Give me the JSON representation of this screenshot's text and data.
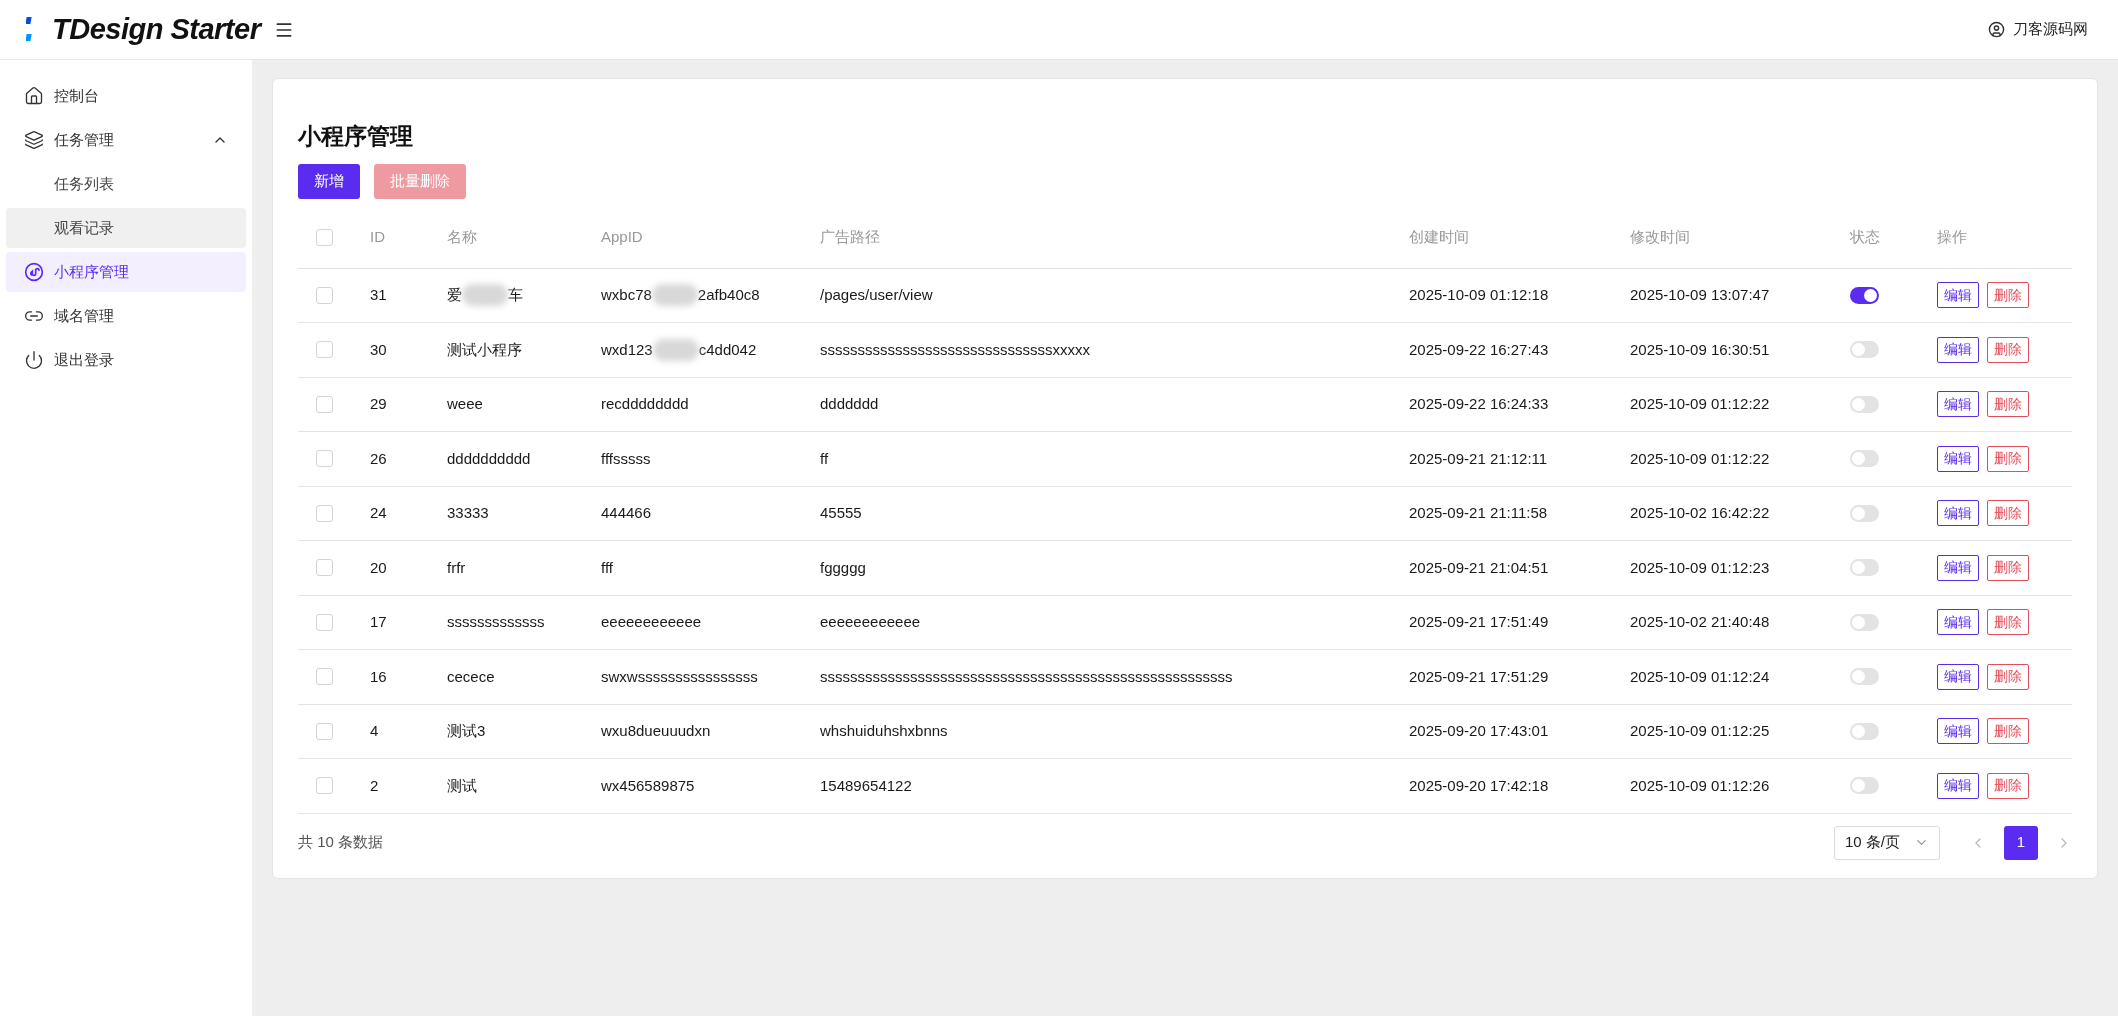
{
  "header": {
    "logo_text": "TDesign Starter",
    "user": "刀客源码网"
  },
  "sidebar": {
    "items": [
      {
        "label": "控制台",
        "selected": false
      },
      {
        "label": "任务管理",
        "selected": false,
        "expanded": true,
        "children": [
          {
            "label": "任务列表",
            "selected": false,
            "hovered": false
          },
          {
            "label": "观看记录",
            "selected": false,
            "hovered": true
          }
        ]
      },
      {
        "label": "小程序管理",
        "selected": true
      },
      {
        "label": "域名管理",
        "selected": false
      },
      {
        "label": "退出登录",
        "selected": false
      }
    ]
  },
  "page": {
    "title": "小程序管理",
    "buttons": [
      {
        "label": "新增",
        "kind": "primary",
        "disabled": false
      },
      {
        "label": "批量删除",
        "kind": "danger",
        "disabled": true
      }
    ]
  },
  "table": {
    "all_checked": false,
    "columns": [
      "ID",
      "名称",
      "AppID",
      "广告路径",
      "创建时间",
      "修改时间",
      "状态",
      "操作"
    ],
    "rows": [
      {
        "checked": false,
        "id": "31",
        "name": {
          "parts": [
            "爱",
            "车"
          ]
        },
        "appid": {
          "parts": [
            "wxbc78",
            "2afb40c8"
          ]
        },
        "path": "/pages/user/view",
        "created": "2025-10-09 01:12:18",
        "modified": "2025-10-09 13:07:47",
        "on": true,
        "actions": [
          "编辑",
          "删除"
        ]
      },
      {
        "checked": false,
        "id": "30",
        "name": "测试小程序",
        "appid": {
          "parts": [
            "wxd123",
            "c4dd042"
          ]
        },
        "path": "sssssssssssssssssssssssssssssssxxxxx",
        "created": "2025-09-22 16:27:43",
        "modified": "2025-10-09 16:30:51",
        "on": false,
        "actions": [
          "编辑",
          "删除"
        ]
      },
      {
        "checked": false,
        "id": "29",
        "name": "weee",
        "appid": "recdddddddd",
        "path": "ddddddd",
        "created": "2025-09-22 16:24:33",
        "modified": "2025-10-09 01:12:22",
        "on": false,
        "actions": [
          "编辑",
          "删除"
        ]
      },
      {
        "checked": false,
        "id": "26",
        "name": "dddddddddd",
        "appid": "fffsssss",
        "path": "ff",
        "created": "2025-09-21 21:12:11",
        "modified": "2025-10-09 01:12:22",
        "on": false,
        "actions": [
          "编辑",
          "删除"
        ]
      },
      {
        "checked": false,
        "id": "24",
        "name": "33333",
        "appid": "444466",
        "path": "45555",
        "created": "2025-09-21 21:11:58",
        "modified": "2025-10-02 16:42:22",
        "on": false,
        "actions": [
          "编辑",
          "删除"
        ]
      },
      {
        "checked": false,
        "id": "20",
        "name": "frfr",
        "appid": "fff",
        "path": "fggggg",
        "created": "2025-09-21 21:04:51",
        "modified": "2025-10-09 01:12:23",
        "on": false,
        "actions": [
          "编辑",
          "删除"
        ]
      },
      {
        "checked": false,
        "id": "17",
        "name": "sssssssssssss",
        "appid": "eeeeeeeeeeee",
        "path": "eeeeeeeeeeee",
        "created": "2025-09-21 17:51:49",
        "modified": "2025-10-02 21:40:48",
        "on": false,
        "actions": [
          "编辑",
          "删除"
        ]
      },
      {
        "checked": false,
        "id": "16",
        "name": "cecece",
        "appid": "swxwssssssssssssssss",
        "path": "sssssssssssssssssssssssssssssssssssssssssssssssssssssss",
        "created": "2025-09-21 17:51:29",
        "modified": "2025-10-09 01:12:24",
        "on": false,
        "actions": [
          "编辑",
          "删除"
        ]
      },
      {
        "checked": false,
        "id": "4",
        "name": "测试3",
        "appid": "wxu8dueuuudxn",
        "path": "whshuiduhshxbnns",
        "created": "2025-09-20 17:43:01",
        "modified": "2025-10-09 01:12:25",
        "on": false,
        "actions": [
          "编辑",
          "删除"
        ]
      },
      {
        "checked": false,
        "id": "2",
        "name": "测试",
        "appid": "wx456589875",
        "path": "15489654122",
        "created": "2025-09-20 17:42:18",
        "modified": "2025-10-09 01:12:26",
        "on": false,
        "actions": [
          "编辑",
          "删除"
        ]
      }
    ]
  },
  "footer": {
    "total": "共 10 条数据",
    "page_size": "10 条/页",
    "pages": [
      {
        "label": "1",
        "selected": true
      }
    ]
  }
}
